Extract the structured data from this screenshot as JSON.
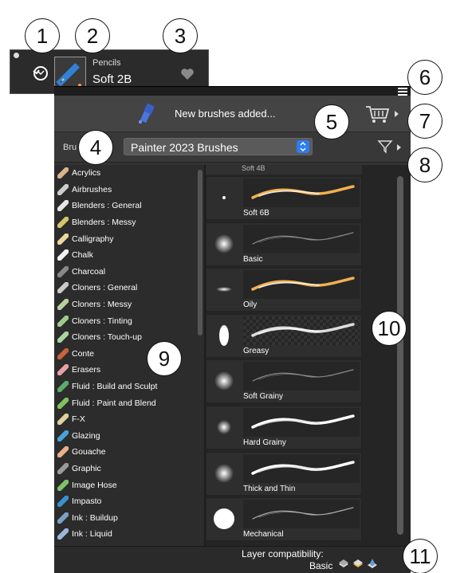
{
  "selector": {
    "category": "Pencils",
    "variant": "Soft 2B"
  },
  "notice": {
    "text": "New brushes added..."
  },
  "library": {
    "label": "Bru",
    "selected": "Painter 2023 Brushes"
  },
  "categories": [
    {
      "label": "Acrylics",
      "color": "#d9b38c"
    },
    {
      "label": "Airbrushes",
      "color": "#cccccc"
    },
    {
      "label": "Blenders : General",
      "color": "#e6e6e6"
    },
    {
      "label": "Blenders : Messy",
      "color": "#d4c56a"
    },
    {
      "label": "Calligraphy",
      "color": "#e8d99a"
    },
    {
      "label": "Chalk",
      "color": "#f2f2f2"
    },
    {
      "label": "Charcoal",
      "color": "#888888"
    },
    {
      "label": "Cloners : General",
      "color": "#c9c9c9"
    },
    {
      "label": "Cloners : Messy",
      "color": "#b5d19f"
    },
    {
      "label": "Cloners : Tinting",
      "color": "#9fc98f"
    },
    {
      "label": "Cloners : Touch-up",
      "color": "#a8d4a0"
    },
    {
      "label": "Conte",
      "color": "#c8623a"
    },
    {
      "label": "Erasers",
      "color": "#e8a0a8"
    },
    {
      "label": "Fluid : Build and Sculpt",
      "color": "#5cab6a"
    },
    {
      "label": "Fluid : Paint and Blend",
      "color": "#7fc35f"
    },
    {
      "label": "F-X",
      "color": "#e0d0a0"
    },
    {
      "label": "Glazing",
      "color": "#4aa0d8"
    },
    {
      "label": "Gouache",
      "color": "#e7b089"
    },
    {
      "label": "Graphic",
      "color": "#9a9a9a"
    },
    {
      "label": "Image Hose",
      "color": "#7cc36a"
    },
    {
      "label": "Impasto",
      "color": "#3a8fd0"
    },
    {
      "label": "Ink : Buildup",
      "color": "#7aa0c8"
    },
    {
      "label": "Ink : Liquid",
      "color": "#9ab8d8"
    }
  ],
  "variants": {
    "partial_top": "Soft 4B",
    "items": [
      {
        "name": "Soft 6B",
        "dab": "dot-small",
        "stroke": "gold"
      },
      {
        "name": "Basic",
        "dab": "soft",
        "stroke": "gray"
      },
      {
        "name": "Oily",
        "dab": "oval",
        "stroke": "gold"
      },
      {
        "name": "Greasy",
        "dab": "ellipse-white",
        "stroke": "white-checker"
      },
      {
        "name": "Soft Grainy",
        "dab": "soft",
        "stroke": "gray"
      },
      {
        "name": "Hard Grainy",
        "dab": "soft-small",
        "stroke": "white-rough"
      },
      {
        "name": "Thick and Thin",
        "dab": "soft",
        "stroke": "white-rough"
      },
      {
        "name": "Mechanical",
        "dab": "hard",
        "stroke": "gray-thin"
      }
    ]
  },
  "footer": {
    "line1": "Layer compatibility:",
    "line2": "Basic"
  },
  "callouts": [
    "1",
    "2",
    "3",
    "4",
    "5",
    "6",
    "7",
    "8",
    "9",
    "10",
    "11"
  ]
}
